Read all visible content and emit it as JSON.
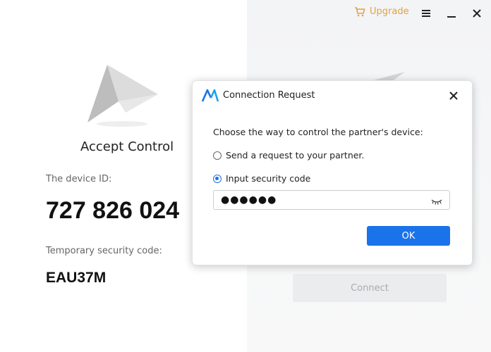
{
  "header": {
    "upgrade_label": "Upgrade",
    "upgrade_color": "#e5a23e"
  },
  "left": {
    "title": "Accept Control",
    "device_id_label": "The device ID:",
    "device_id": "727 826 024",
    "security_code_label": "Temporary security code:",
    "security_code": "EAU37M"
  },
  "right": {
    "connect_label": "Connect"
  },
  "dialog": {
    "title": "Connection Request",
    "prompt": "Choose the way to control the partner's device:",
    "options": [
      {
        "label": "Send a request to your partner.",
        "selected": false
      },
      {
        "label": "Input security code",
        "selected": true
      }
    ],
    "password_value": "●●●●●●",
    "ok_label": "OK",
    "accent_color": "#1a73e8"
  },
  "icons": [
    "cart-icon",
    "menu-icon",
    "minimize-icon",
    "close-icon",
    "paper-plane-icon",
    "app-logo-icon",
    "eye-closed-icon"
  ]
}
